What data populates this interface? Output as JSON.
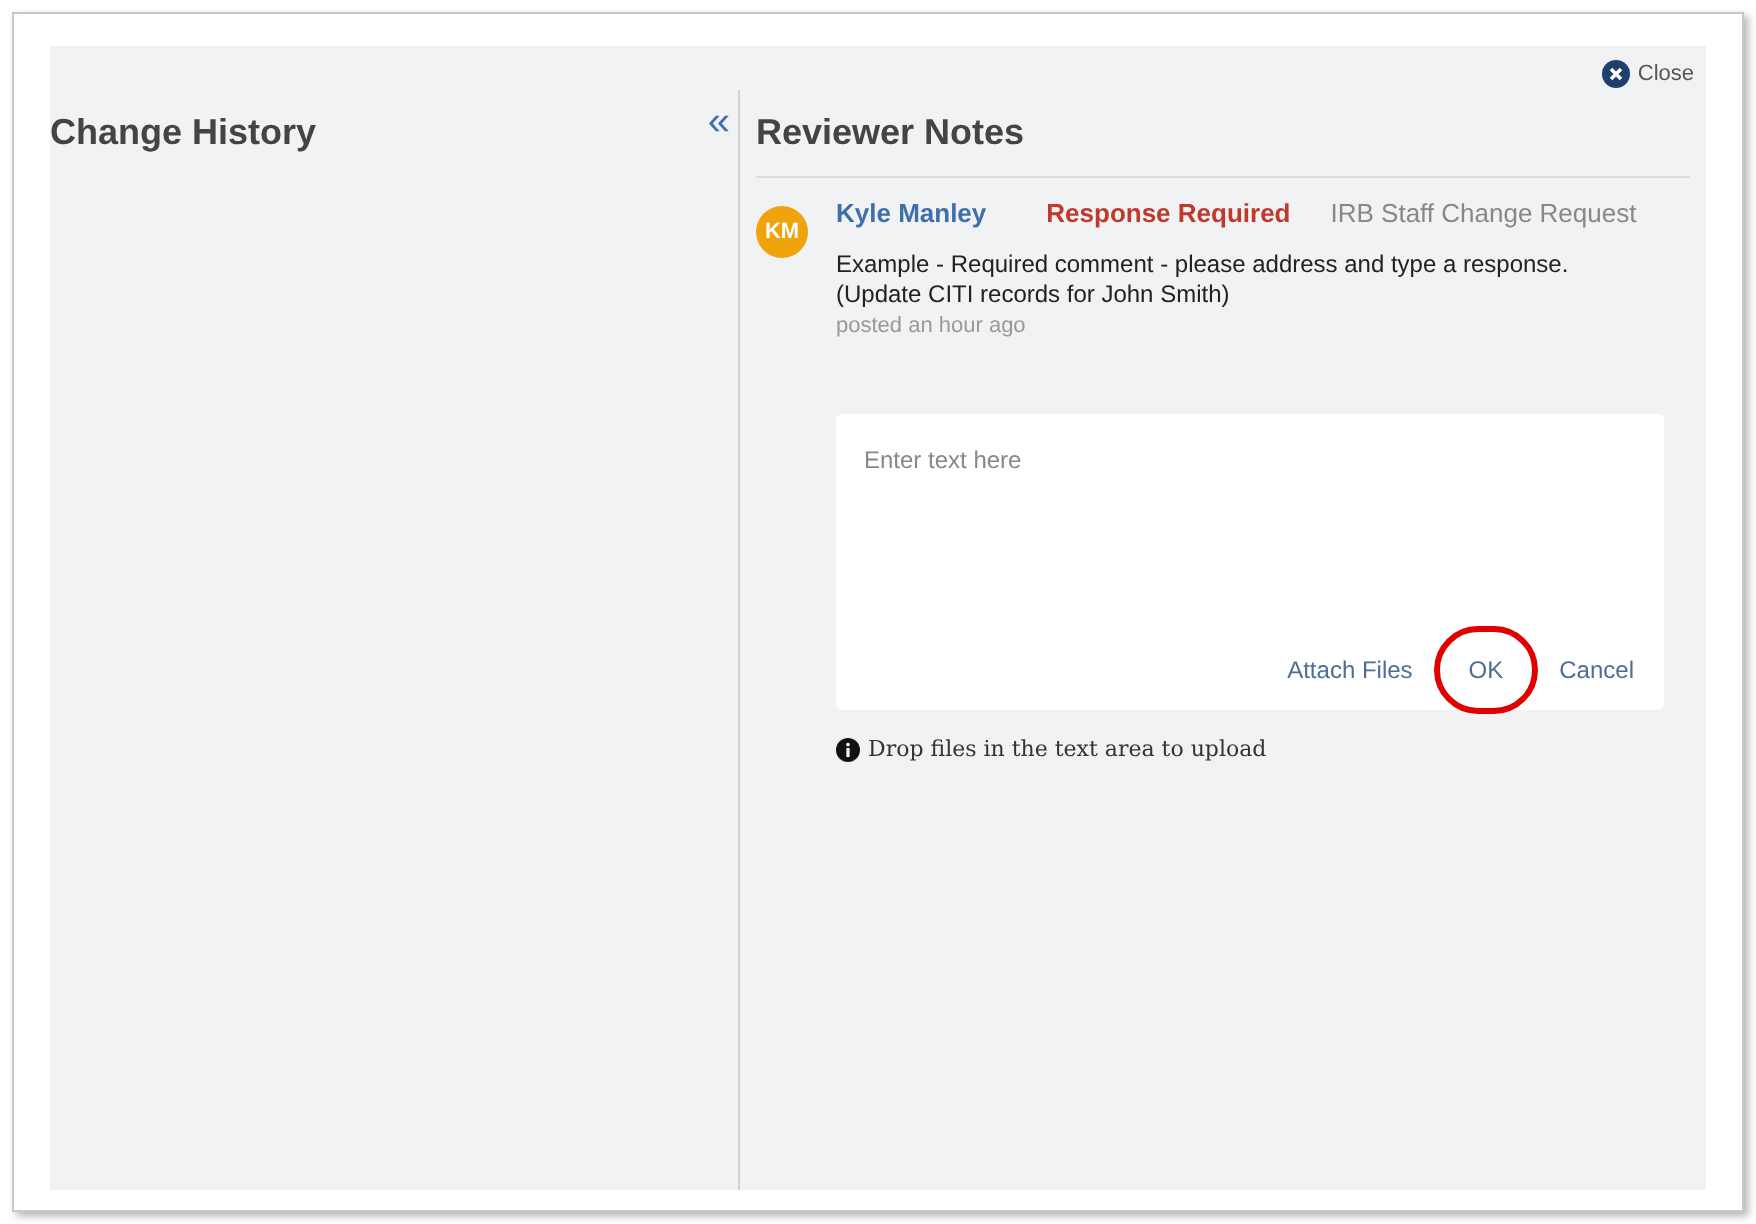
{
  "close": {
    "label": "Close"
  },
  "change_history": {
    "title": "Change History",
    "collapse_icon": "«"
  },
  "reviewer_notes": {
    "title": "Reviewer Notes",
    "note": {
      "avatar": "KM",
      "author": "Kyle Manley",
      "status": "Response Required",
      "category": "IRB Staff Change Request",
      "lines": [
        "Example - Required comment - please address and type a response.",
        "(Update CITI records for John Smith)"
      ],
      "time": "posted an hour ago"
    },
    "reply": {
      "placeholder": "Enter text here",
      "actions": [
        {
          "label": "Attach Files",
          "circled": false
        },
        {
          "label": "OK",
          "circled": true
        },
        {
          "label": "Cancel",
          "circled": false
        }
      ]
    },
    "hint": "Drop files in the text area to upload"
  }
}
